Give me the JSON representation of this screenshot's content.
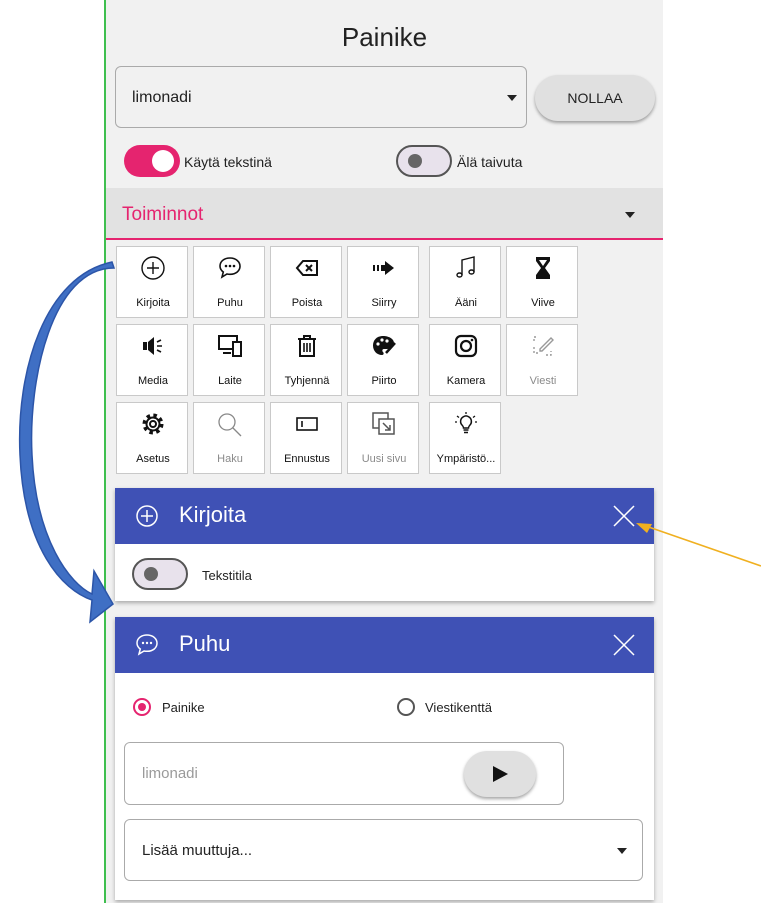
{
  "title": "Painike",
  "symbol_select": {
    "value": "limonadi"
  },
  "reset_button": "NOLLAA",
  "toggles": {
    "use_as_text": {
      "label": "Käytä tekstinä",
      "on": true
    },
    "no_inflect": {
      "label": "Älä taivuta",
      "on": false
    }
  },
  "actions_section": {
    "label": "Toiminnot"
  },
  "actions": [
    {
      "label": "Kirjoita",
      "icon": "plus-circle-icon",
      "enabled": true
    },
    {
      "label": "Puhu",
      "icon": "speech-bubble-icon",
      "enabled": true
    },
    {
      "label": "Poista",
      "icon": "backspace-icon",
      "enabled": true
    },
    {
      "label": "Siirry",
      "icon": "arrow-right-icon",
      "enabled": true
    },
    {
      "label": "Ääni",
      "icon": "music-note-icon",
      "enabled": true
    },
    {
      "label": "Viive",
      "icon": "hourglass-icon",
      "enabled": true
    },
    {
      "label": "Media",
      "icon": "speaker-icon",
      "enabled": true
    },
    {
      "label": "Laite",
      "icon": "devices-icon",
      "enabled": true
    },
    {
      "label": "Tyhjennä",
      "icon": "trash-icon",
      "enabled": true
    },
    {
      "label": "Piirto",
      "icon": "palette-icon",
      "enabled": true
    },
    {
      "label": "Kamera",
      "icon": "camera-icon",
      "enabled": true
    },
    {
      "label": "Viesti",
      "icon": "edit-message-icon",
      "enabled": false
    },
    {
      "label": "Asetus",
      "icon": "gear-icon",
      "enabled": true
    },
    {
      "label": "Haku",
      "icon": "search-icon",
      "enabled": false
    },
    {
      "label": "Ennustus",
      "icon": "prediction-icon",
      "enabled": true
    },
    {
      "label": "Uusi sivu",
      "icon": "new-page-icon",
      "enabled": false
    },
    {
      "label": "Ympäristö...",
      "icon": "lightbulb-icon",
      "enabled": true
    }
  ],
  "write_card": {
    "title": "Kirjoita",
    "text_mode": {
      "label": "Tekstitila",
      "on": false
    }
  },
  "speak_card": {
    "title": "Puhu",
    "radio_button": "Painike",
    "radio_message": "Viestikenttä",
    "selected": "Painike",
    "text_placeholder": "limonadi",
    "variables_select": "Lisää muuttuja..."
  },
  "colors": {
    "accent": "#e5246f",
    "header": "#3f51b5",
    "annotation_arrow": "#3f6fc4",
    "pointer": "#f0b020"
  }
}
